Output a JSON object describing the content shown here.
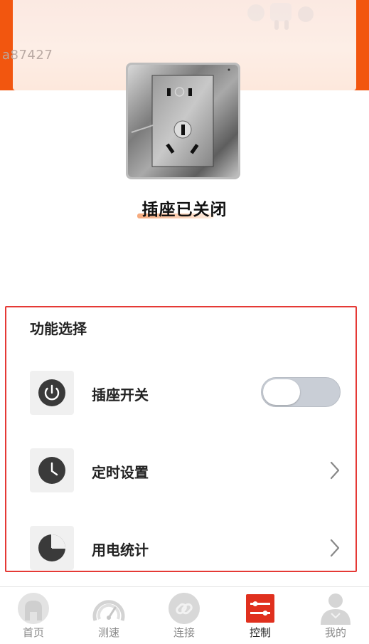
{
  "header": {
    "device_id": "a87427"
  },
  "socket": {
    "status_text": "插座已关闭"
  },
  "panel": {
    "title": "功能选择",
    "items": [
      {
        "label": "插座开关",
        "icon": "power-icon",
        "control": "toggle",
        "toggle_on": false
      },
      {
        "label": "定时设置",
        "icon": "clock-icon",
        "control": "chevron"
      },
      {
        "label": "用电统计",
        "icon": "pie-chart-icon",
        "control": "chevron"
      }
    ]
  },
  "tabbar": {
    "tabs": [
      {
        "label": "首页",
        "icon": "home-icon",
        "active": false
      },
      {
        "label": "测速",
        "icon": "speedometer-icon",
        "active": false
      },
      {
        "label": "连接",
        "icon": "link-icon",
        "active": false
      },
      {
        "label": "控制",
        "icon": "control-sliders-icon",
        "active": true
      },
      {
        "label": "我的",
        "icon": "user-icon",
        "active": false
      }
    ]
  },
  "colors": {
    "brand_orange": "#f2560f",
    "panel_border": "#e53935",
    "active_tab": "#e0301e",
    "inactive_tab": "#c8c8c8"
  }
}
